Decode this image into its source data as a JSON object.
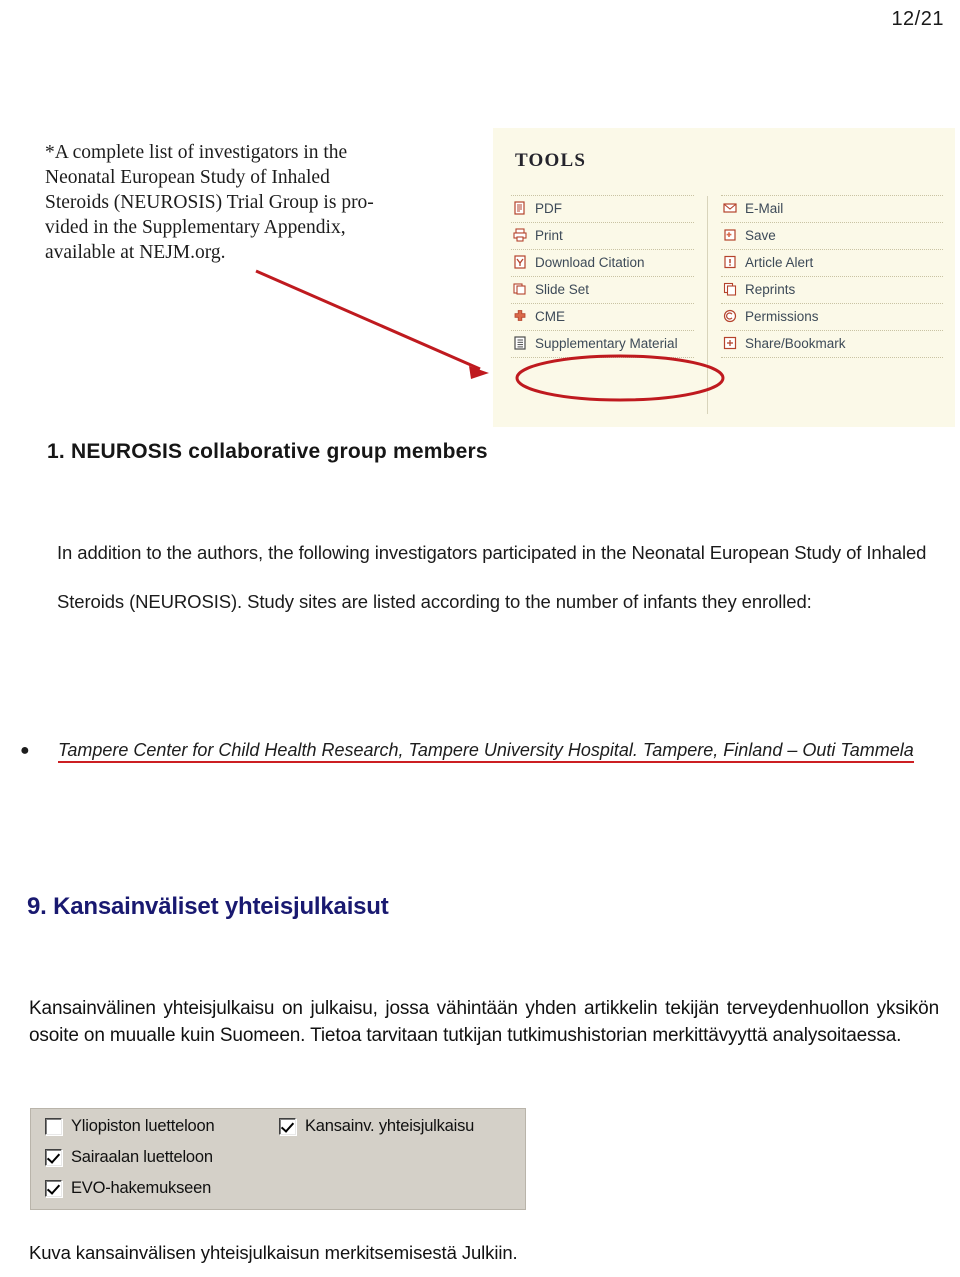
{
  "page": {
    "page_number": "12/21"
  },
  "nejm_screenshot": {
    "footnote_lines": [
      "*A complete list of investigators in the",
      "Neonatal European Study of Inhaled",
      "Steroids (NEUROSIS) Trial Group is pro-",
      "vided in the Supplementary Appendix,",
      "available at NEJM.org."
    ],
    "tools": {
      "title": "TOOLS",
      "left_column": [
        {
          "label": "PDF",
          "icon": "pdf-document-icon"
        },
        {
          "label": "Print",
          "icon": "printer-icon"
        },
        {
          "label": "Download Citation",
          "icon": "download-citation-icon"
        },
        {
          "label": "Slide Set",
          "icon": "slide-set-icon"
        },
        {
          "label": "CME",
          "icon": "plus-cross-icon"
        },
        {
          "label": "Supplementary Material",
          "icon": "list-document-icon"
        }
      ],
      "right_column": [
        {
          "label": "E-Mail",
          "icon": "envelope-icon"
        },
        {
          "label": "Save",
          "icon": "save-folder-icon"
        },
        {
          "label": "Article Alert",
          "icon": "alert-exclamation-icon"
        },
        {
          "label": "Reprints",
          "icon": "copy-pages-icon"
        },
        {
          "label": "Permissions",
          "icon": "copyright-icon"
        },
        {
          "label": "Share/Bookmark",
          "icon": "plus-square-icon"
        }
      ]
    },
    "annotation": {
      "highlight_color": "#bf1a1f",
      "highlighted_item": "Supplementary Material"
    }
  },
  "appendix": {
    "heading": "1. NEUROSIS collaborative group members",
    "paragraph": "In addition to the authors, the following investigators participated in the Neonatal European Study of Inhaled Steroids (NEUROSIS). Study sites are listed according to the number of infants they enrolled:",
    "site_entry": "Tampere Center for Child Health Research, Tampere University Hospital. Tampere, Finland – Outi Tammela"
  },
  "section": {
    "heading": "9. Kansainväliset yhteisjulkaisut",
    "paragraph": "Kansainvälinen yhteisjulkaisu on julkaisu, jossa vähintään yhden artikkelin tekijän terveydenhuollon yksikön osoite on muualle kuin Suomeen. Tietoa tarvitaan tutkijan tutkimushistorian merkittävyyttä analysoitaessa.",
    "heading_color": "#191970"
  },
  "checkbox_dialog": {
    "options": [
      {
        "label": "Yliopiston luetteloon",
        "checked": false
      },
      {
        "label": "Sairaalan luetteloon",
        "checked": true
      },
      {
        "label": "EVO-hakemukseen",
        "checked": true
      },
      {
        "label": "Kansainv. yhteisjulkaisu",
        "checked": true
      }
    ]
  },
  "figure_caption": "Kuva kansainvälisen yhteisjulkaisun merkitsemisestä Julkiin."
}
